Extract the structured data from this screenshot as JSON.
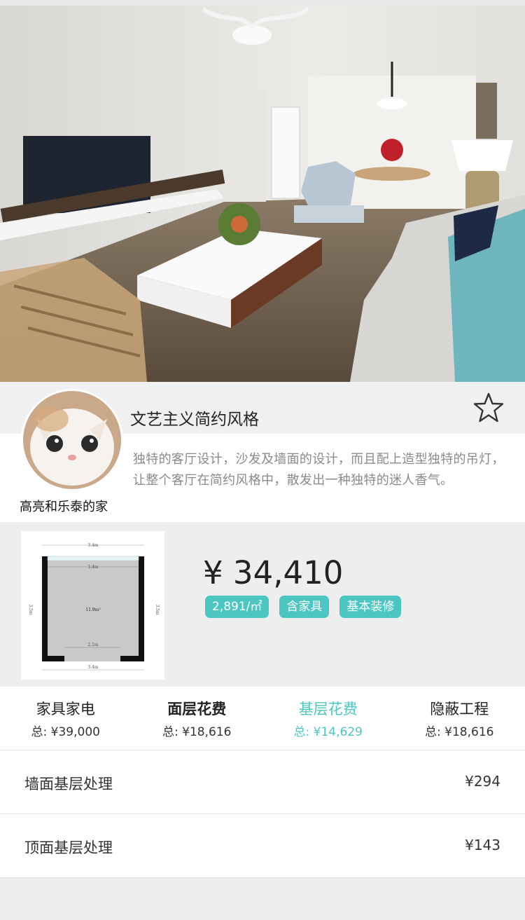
{
  "hero": {
    "image": "living-room-photo"
  },
  "design": {
    "title": "文艺主义简约风格",
    "description": "独特的客厅设计，沙发及墙面的设计，而且配上造型独特的吊灯，让整个客厅在简约风格中，散发出一种独特的迷人香气。",
    "author": "高亮和乐泰的家",
    "favorite_icon": "star-outline-icon"
  },
  "floorplan": {
    "top_dim": "3.4m",
    "inner_top_dim": "3.4m",
    "area": "11.9m²",
    "left_dim": "3.5m",
    "right_dim": "3.5m",
    "door_dim": "2.1m",
    "bottom_dim": "3.4m"
  },
  "pricing": {
    "total": "¥ 34,410",
    "tags": [
      "2,891/㎡",
      "含家具",
      "基本装修"
    ]
  },
  "categories": [
    {
      "name": "家具家电",
      "total": "总: ¥39,000"
    },
    {
      "name": "面层花费",
      "total": "总: ¥18,616"
    },
    {
      "name": "基层花费",
      "total": "总: ¥14,629"
    },
    {
      "name": "隐蔽工程",
      "total": "总: ¥18,616"
    }
  ],
  "items": [
    {
      "label": "墙面基层处理",
      "value": "¥294"
    },
    {
      "label": "顶面基层处理",
      "value": "¥143"
    }
  ],
  "colors": {
    "accent": "#4cc6c0"
  }
}
